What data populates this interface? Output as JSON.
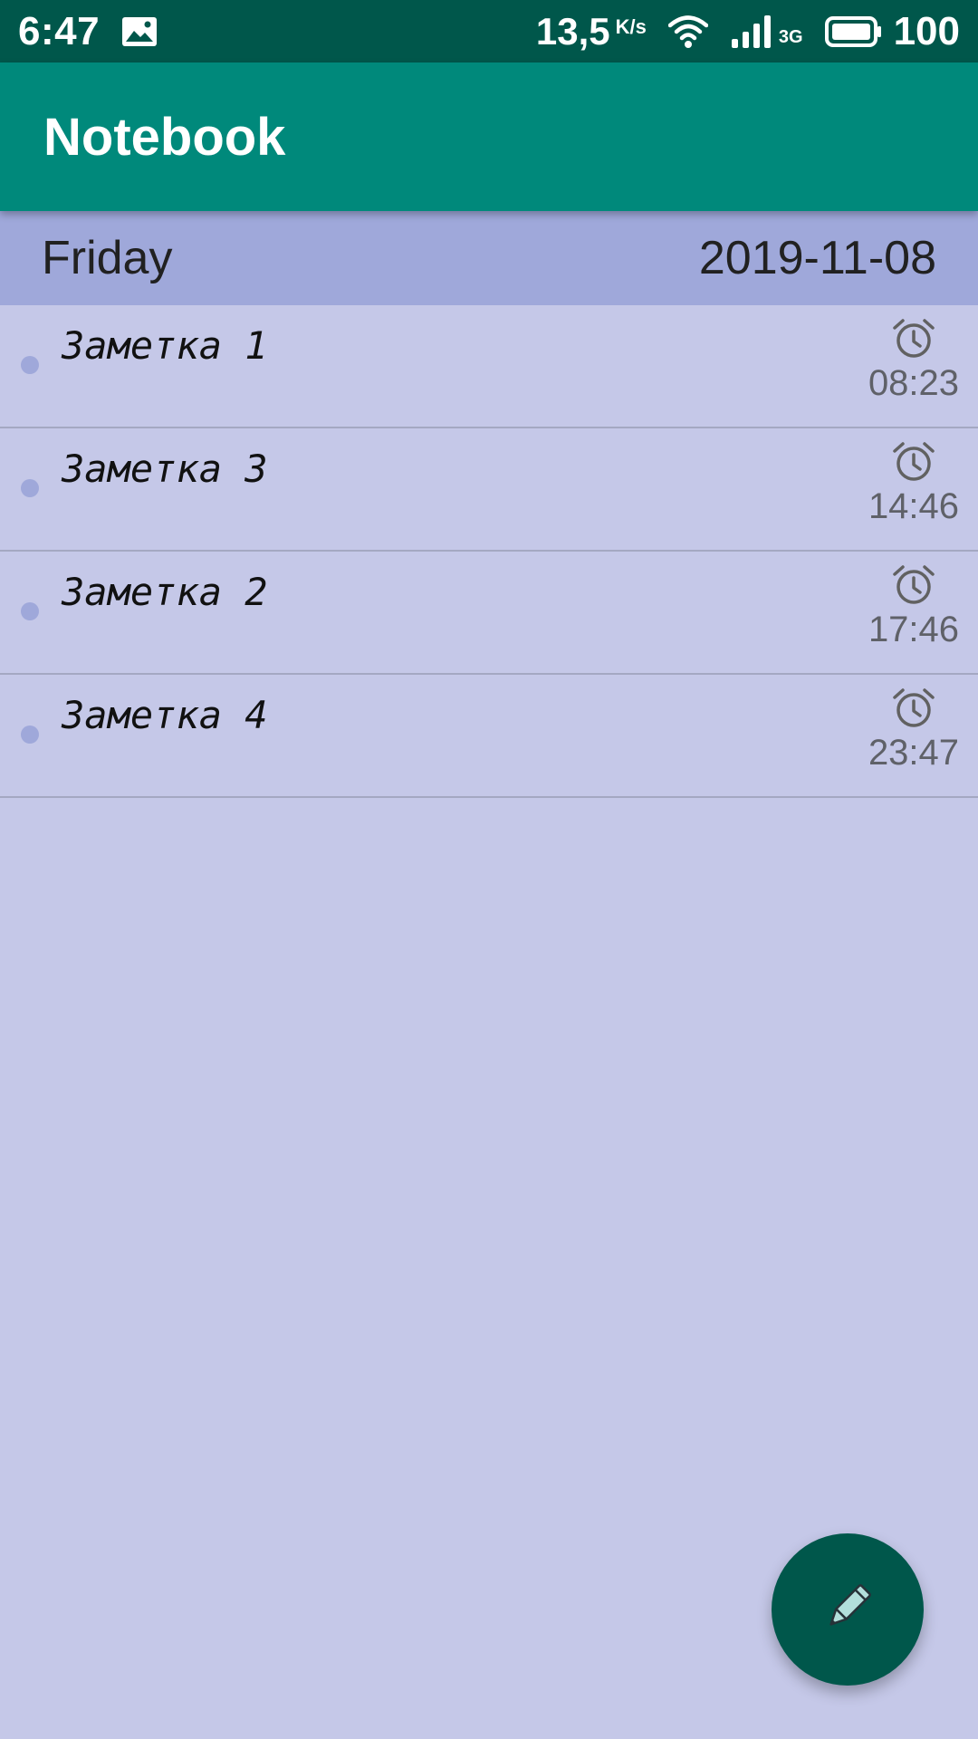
{
  "status_bar": {
    "time": "6:47",
    "net_speed": "13,5",
    "net_speed_unit": "K/s",
    "network_type": "3G",
    "battery": "100"
  },
  "app_bar": {
    "title": "Notebook"
  },
  "day_header": {
    "day": "Friday",
    "date": "2019-11-08"
  },
  "notes": [
    {
      "title": "Заметка 1",
      "time": "08:23"
    },
    {
      "title": "Заметка 3",
      "time": "14:46"
    },
    {
      "title": "Заметка 2",
      "time": "17:46"
    },
    {
      "title": "Заметка 4",
      "time": "23:47"
    }
  ],
  "icons": {
    "gallery": "image-icon",
    "wifi": "wifi-icon",
    "signal": "signal-icon",
    "battery": "battery-icon",
    "alarm": "alarm-clock-icon",
    "fab": "pencil-icon"
  },
  "colors": {
    "status_bar": "#00574B",
    "app_bar": "#00897B",
    "day_header": "#9FA8DA",
    "background": "#C5C8E8",
    "fab": "#00574B"
  }
}
